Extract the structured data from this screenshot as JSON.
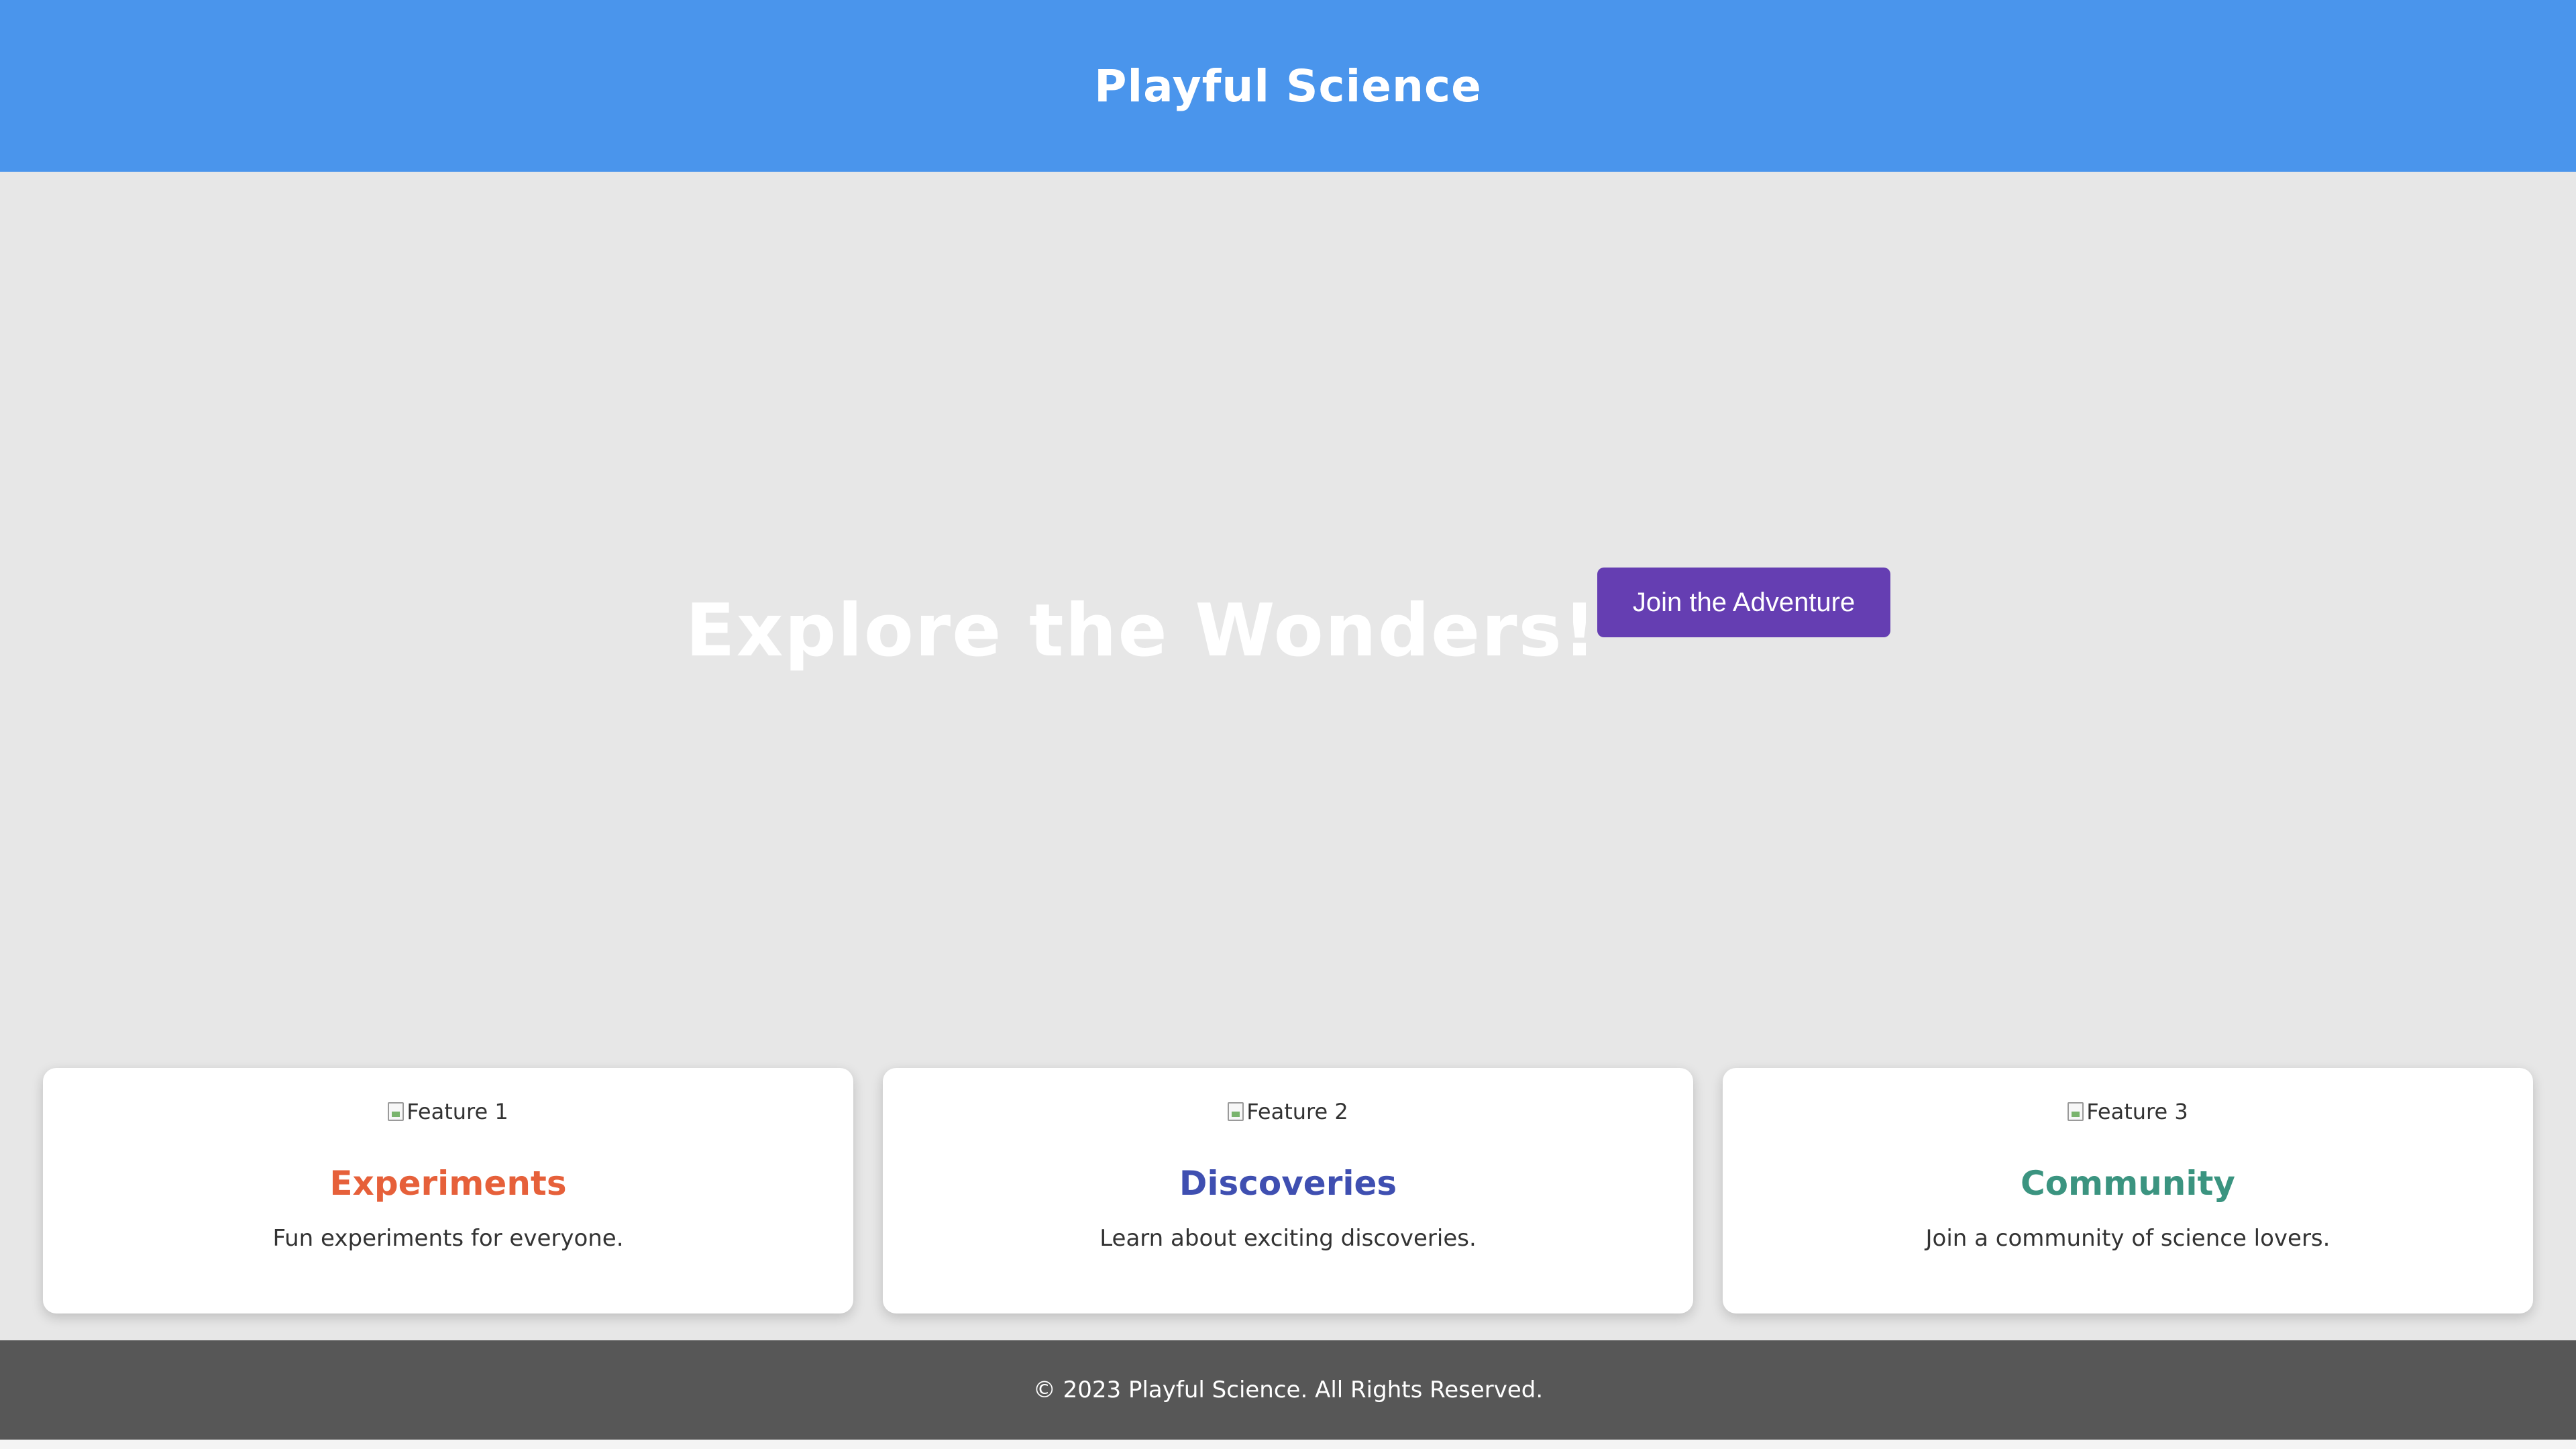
{
  "header": {
    "title": "Playful Science",
    "background": "#4a95ec"
  },
  "hero": {
    "title": "Explore the Wonders!",
    "button_label": "Join the Adventure",
    "button_color": "#653eb2",
    "background": "#e7e7e7"
  },
  "features": [
    {
      "image_alt": "Feature 1",
      "title": "Experiments",
      "text": "Fun experiments for everyone.",
      "title_color": "#e6603a"
    },
    {
      "image_alt": "Feature 2",
      "title": "Discoveries",
      "text": "Learn about exciting discoveries.",
      "title_color": "#3f4fb1"
    },
    {
      "image_alt": "Feature 3",
      "title": "Community",
      "text": "Join a community of science lovers.",
      "title_color": "#3b9480"
    }
  ],
  "footer": {
    "text": "© 2023 Playful Science. All Rights Reserved.",
    "background": "#575757"
  }
}
